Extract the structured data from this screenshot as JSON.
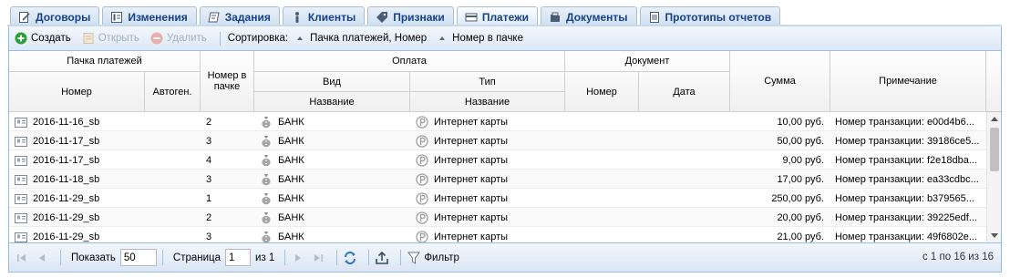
{
  "tabs": [
    {
      "label": "Договоры",
      "icon": "contract-icon",
      "active": false
    },
    {
      "label": "Изменения",
      "icon": "changes-icon",
      "active": false
    },
    {
      "label": "Задания",
      "icon": "tasks-icon",
      "active": false
    },
    {
      "label": "Клиенты",
      "icon": "person-icon",
      "active": false
    },
    {
      "label": "Признаки",
      "icon": "tag-icon",
      "active": false
    },
    {
      "label": "Платежи",
      "icon": "payment-icon",
      "active": true
    },
    {
      "label": "Документы",
      "icon": "documents-icon",
      "active": false
    },
    {
      "label": "Прототипы отчетов",
      "icon": "report-icon",
      "active": false
    }
  ],
  "toolbar": {
    "create_label": "Создать",
    "open_label": "Открыть",
    "delete_label": "Удалить",
    "sort_label": "Сортировка:",
    "sort_items": [
      "Пачка платежей, Номер",
      "Номер в пачке"
    ]
  },
  "header": {
    "group_pack": "Пачка платежей",
    "pack_number": "Номер",
    "pack_autogen": "Автоген.",
    "number_in_pack": "Номер в пачке",
    "group_payment": "Оплата",
    "kind": "Вид",
    "kind_name": "Название",
    "type": "Тип",
    "type_name": "Название",
    "group_document": "Документ",
    "doc_number": "Номер",
    "doc_date": "Дата",
    "amount": "Сумма",
    "note": "Примечание"
  },
  "rows": [
    {
      "pack": "2016-11-16_sb",
      "autogen": "",
      "num": "2",
      "kind": "БАНК",
      "type": "Интернет карты",
      "doc_number": "",
      "doc_date": "",
      "amount": "10,00 руб.",
      "note": "Номер транзакции: e00d4b6..."
    },
    {
      "pack": "2016-11-17_sb",
      "autogen": "",
      "num": "3",
      "kind": "БАНК",
      "type": "Интернет карты",
      "doc_number": "",
      "doc_date": "",
      "amount": "50,00 руб.",
      "note": "Номер транзакции: 39186ce5..."
    },
    {
      "pack": "2016-11-17_sb",
      "autogen": "",
      "num": "4",
      "kind": "БАНК",
      "type": "Интернет карты",
      "doc_number": "",
      "doc_date": "",
      "amount": "9,00 руб.",
      "note": "Номер транзакции: f2e18dba..."
    },
    {
      "pack": "2016-11-18_sb",
      "autogen": "",
      "num": "3",
      "kind": "БАНК",
      "type": "Интернет карты",
      "doc_number": "",
      "doc_date": "",
      "amount": "17,00 руб.",
      "note": "Номер транзакции: ea33cdbc..."
    },
    {
      "pack": "2016-11-29_sb",
      "autogen": "",
      "num": "1",
      "kind": "БАНК",
      "type": "Интернет карты",
      "doc_number": "",
      "doc_date": "",
      "amount": "250,00 руб.",
      "note": "Номер транзакции: b379565..."
    },
    {
      "pack": "2016-11-29_sb",
      "autogen": "",
      "num": "2",
      "kind": "БАНК",
      "type": "Интернет карты",
      "doc_number": "",
      "doc_date": "",
      "amount": "20,00 руб.",
      "note": "Номер транзакции: 39225edf..."
    },
    {
      "pack": "2016-11-29_sb",
      "autogen": "",
      "num": "3",
      "kind": "БАНК",
      "type": "Интернет карты",
      "doc_number": "",
      "doc_date": "",
      "amount": "21,00 руб.",
      "note": "Номер транзакции: 49f6802e..."
    }
  ],
  "pager": {
    "show_label": "Показать",
    "page_size": "50",
    "page_label": "Страница",
    "page_value": "1",
    "of_label": "из 1",
    "filter_label": "Фильтр",
    "summary": "с 1 по 16 из 16"
  },
  "colors": {
    "tab_text": "#15428b",
    "border": "#99bbe8",
    "create_icon": "#2e9e3b",
    "delete_icon": "#d24a3c"
  }
}
